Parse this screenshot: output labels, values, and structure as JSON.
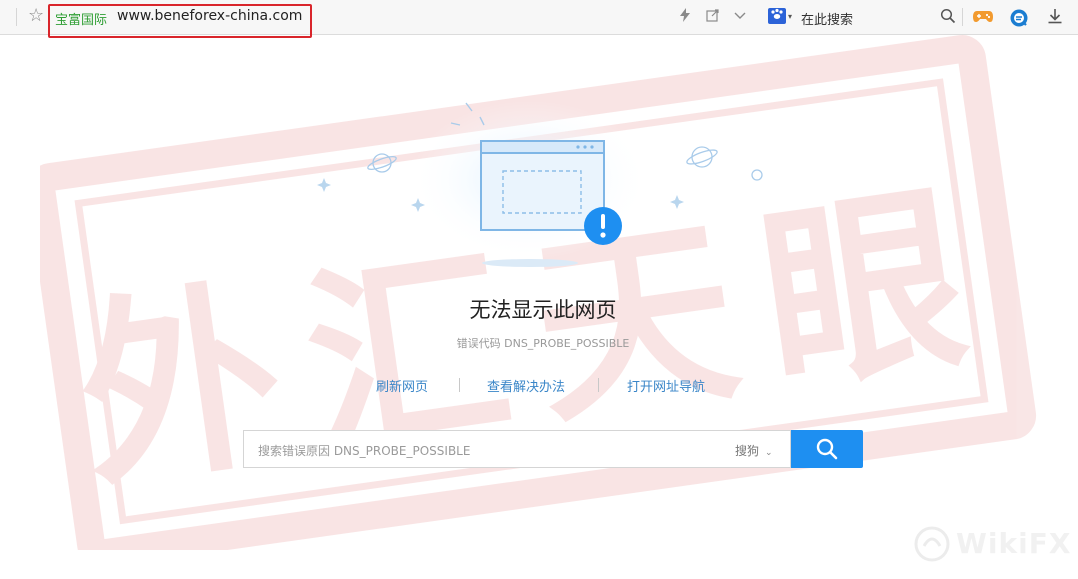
{
  "toolbar": {
    "site_name": "宝富国际",
    "url": "www.beneforex-china.com",
    "search_placeholder": "在此搜索",
    "icons": [
      "star-icon",
      "lightning-icon",
      "share-icon",
      "chevron-down-icon",
      "search-engine-icon",
      "magnifier-icon",
      "game-icon",
      "browser-ext-icon",
      "download-icon"
    ]
  },
  "error": {
    "title": "无法显示此网页",
    "code": "错误代码 DNS_PROBE_POSSIBLE",
    "links": [
      "刷新网页",
      "查看解决办法",
      "打开网址导航"
    ]
  },
  "search": {
    "placeholder": "搜索错误原因 DNS_PROBE_POSSIBLE",
    "engine": "搜狗"
  },
  "stamp": {
    "text": "外汇天眼",
    "color": "#d23a3a"
  },
  "watermark": {
    "text": "WikiFX"
  },
  "colors": {
    "link": "#3a86c8",
    "button": "#1e8ff1",
    "site_name": "#2e9e33",
    "highlight_box": "#d9252b"
  }
}
